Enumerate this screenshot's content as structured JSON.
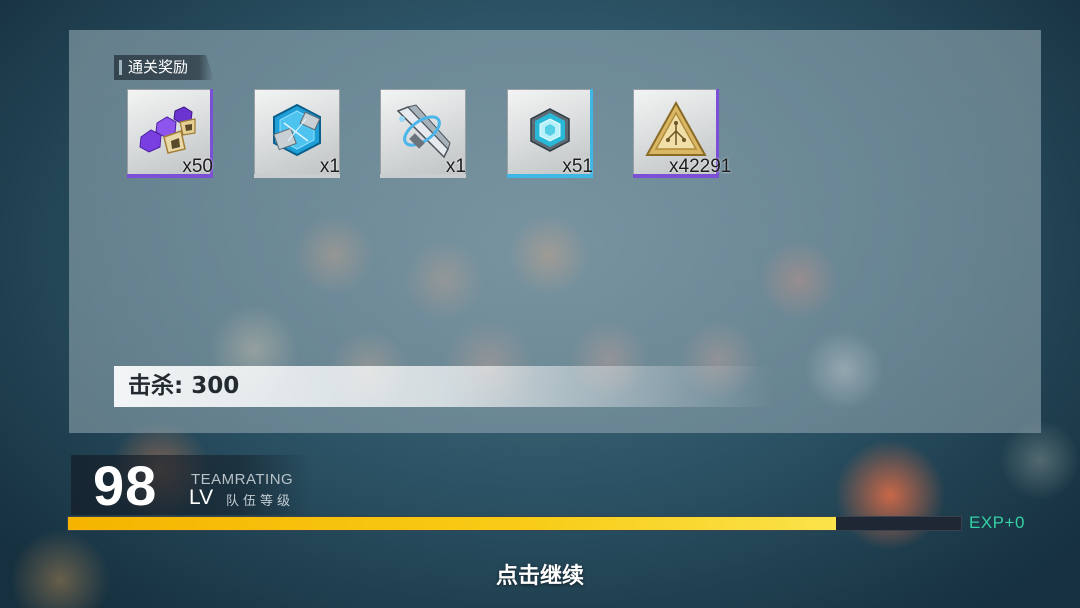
{
  "rewards_section": {
    "title": "通关奖励",
    "items": [
      {
        "icon": "purple-crystal-shards-icon",
        "count": "x50",
        "rarity_color": "#7b4fd6"
      },
      {
        "icon": "blue-chip-module-icon",
        "count": "x1",
        "rarity_color": "#c9cdd0"
      },
      {
        "icon": "silver-blade-weapon-icon",
        "count": "x1",
        "rarity_color": "#c9cdd0"
      },
      {
        "icon": "cyan-hex-gem-icon",
        "count": "x51",
        "rarity_color": "#3fb6e6"
      },
      {
        "icon": "gold-triangle-circuit-icon",
        "count": "x42291",
        "rarity_color": "#7b4fd6"
      }
    ]
  },
  "kills": {
    "label": "击杀: 300"
  },
  "team": {
    "level": "98",
    "rating_label": "TEAMRATING",
    "lv_label": "LV",
    "level_caption": "队伍等级"
  },
  "exp": {
    "progress": 0.86,
    "label": "EXP+0",
    "fill_color": "#f7c10d",
    "text_color": "#35d0a4"
  },
  "continue_prompt": "点击继续"
}
